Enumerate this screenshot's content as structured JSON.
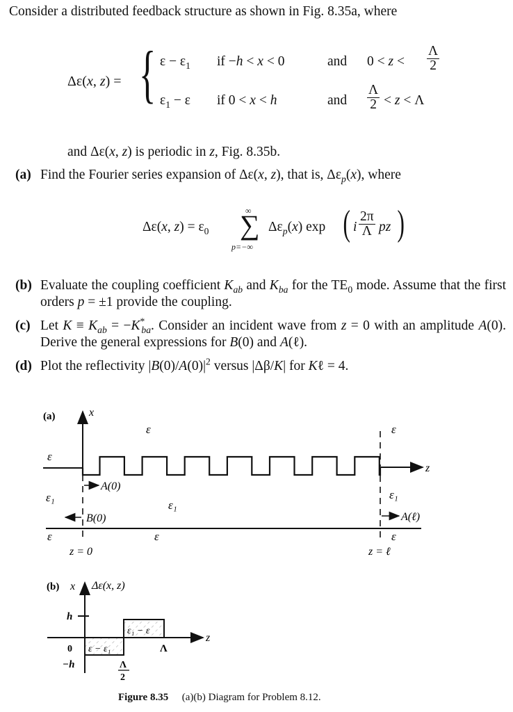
{
  "intro": "Consider a distributed feedback structure as shown in Fig. 8.35a, where",
  "equation1": {
    "lhs": "Δε(x, z) =",
    "case1": {
      "expr": "ε − ε₁",
      "cond": "if −h < x < 0",
      "and": "and",
      "zcond_left": "0 < z <",
      "frac_num": "Λ",
      "frac_den": "2"
    },
    "case2": {
      "expr": "ε₁ − ε",
      "cond": "if 0 < x < h",
      "and": "and",
      "frac_num": "Λ",
      "frac_den": "2",
      "zcond_right": "< z < Λ"
    }
  },
  "periodic_text": "and Δε(x, z) is periodic in z, Fig. 8.35b.",
  "parts": [
    {
      "label": "(a)",
      "text": "Find the Fourier series expansion of Δε(x, z), that is, Δεp(x), where"
    },
    {
      "label": "(b)",
      "text_html": "Evaluate the coupling coefficient K_ab and K_ba for the TE0 mode. Assume that the first orders p = ±1 provide the coupling."
    },
    {
      "label": "(c)",
      "text_html": "Let K ≡ K_ab = −K*_ba. Consider an incident wave from z = 0 with an amplitude A(0). Derive the general expressions for B(0) and A(ℓ)."
    },
    {
      "label": "(d)",
      "text_html": "Plot the reflectivity |B(0)/A(0)|² versus |Δβ/K| for Kℓ = 4."
    }
  ],
  "equation2": {
    "lhs": "Δε(x, z) = ε₀",
    "sum_top": "∞",
    "sum_bottom": "p=−∞",
    "term": "Δεp(x) exp",
    "frac_num": "2π",
    "frac_den": "Λ",
    "i": "i",
    "pz": "pz"
  },
  "figure_a": {
    "label": "(a)",
    "x_axis": "x",
    "z_axis": "z",
    "eps": "ε",
    "eps1": "ε₁",
    "A0": "A(0)",
    "B0": "B(0)",
    "Al": "A(ℓ)",
    "z0": "z = 0",
    "zl": "z = ℓ",
    "grating_periods": 7
  },
  "figure_b": {
    "label": "(b)",
    "x_axis": "x",
    "y_title": "Δε(x, z)",
    "z_axis": "z",
    "h": "h",
    "minus_h": "−h",
    "origin": "0",
    "Lambda": "Λ",
    "half_num": "Λ",
    "half_den": "2",
    "upper_box": "ε₁ − ε",
    "lower_box": "ε − ε₁"
  },
  "caption": {
    "figure": "Figure 8.35",
    "text": "(a)(b) Diagram for Problem 8.12."
  }
}
